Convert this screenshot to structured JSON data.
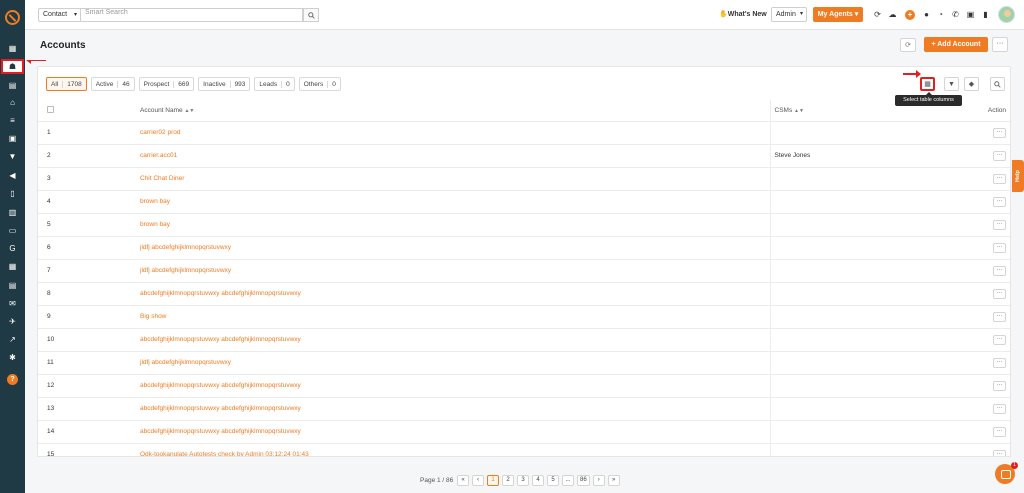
{
  "header": {
    "entity_select": "Contact",
    "search_placeholder": "Smart Search",
    "whats_new": "What's New",
    "role_select": "Admin",
    "my_agents": "My Agents"
  },
  "page": {
    "title": "Accounts",
    "add_account": "Add Account"
  },
  "filters": [
    {
      "label": "All",
      "count": "1708"
    },
    {
      "label": "Active",
      "count": "46"
    },
    {
      "label": "Prospect",
      "count": "669"
    },
    {
      "label": "Inactive",
      "count": "993"
    },
    {
      "label": "Leads",
      "count": "0"
    },
    {
      "label": "Others",
      "count": "0"
    }
  ],
  "tooltip": "Select table columns",
  "table": {
    "columns": {
      "name": "Account Name",
      "csm": "CSMs",
      "action": "Action"
    },
    "rows": [
      {
        "idx": "1",
        "name": "carrier02 prod",
        "csm": ""
      },
      {
        "idx": "2",
        "name": "carrier.acc01",
        "csm": "Steve Jones"
      },
      {
        "idx": "3",
        "name": "Chit Chat Diner",
        "csm": ""
      },
      {
        "idx": "4",
        "name": "brown bay",
        "csm": ""
      },
      {
        "idx": "5",
        "name": "brown bay",
        "csm": ""
      },
      {
        "idx": "6",
        "name": "jldfj abcdefghijklmnopqrstuvwxy",
        "csm": ""
      },
      {
        "idx": "7",
        "name": "jldfj abcdefghijklmnopqrstuvwxy",
        "csm": ""
      },
      {
        "idx": "8",
        "name": "abcdefghijklmnopqrstuvwxy abcdefghijklmnopqrstuvwxy",
        "csm": ""
      },
      {
        "idx": "9",
        "name": "Big show",
        "csm": ""
      },
      {
        "idx": "10",
        "name": "abcdefghijklmnopqrstuvwxy abcdefghijklmnopqrstuvwxy",
        "csm": ""
      },
      {
        "idx": "11",
        "name": "jldfj abcdefghijklmnopqrstuvwxy",
        "csm": ""
      },
      {
        "idx": "12",
        "name": "abcdefghijklmnopqrstuvwxy abcdefghijklmnopqrstuvwxy",
        "csm": ""
      },
      {
        "idx": "13",
        "name": "abcdefghijklmnopqrstuvwxy abcdefghijklmnopqrstuvwxy",
        "csm": ""
      },
      {
        "idx": "14",
        "name": "abcdefghijklmnopqrstuvwxy abcdefghijklmnopqrstuvwxy",
        "csm": ""
      },
      {
        "idx": "15",
        "name": "Odk-tookanulate Autotests check by Admin 03:12:24 01:43",
        "csm": ""
      }
    ]
  },
  "pagination": {
    "info": "Page 1 / 86",
    "first": "«",
    "prev": "‹",
    "pages": [
      "1",
      "2",
      "3",
      "4",
      "5",
      "...",
      "86"
    ],
    "next": "›",
    "last": "»"
  },
  "help_tab": "Help",
  "chat_badge": "1",
  "colors": {
    "accent": "#f07b22",
    "sidebar": "#1f3a44",
    "highlight": "#e02020"
  }
}
